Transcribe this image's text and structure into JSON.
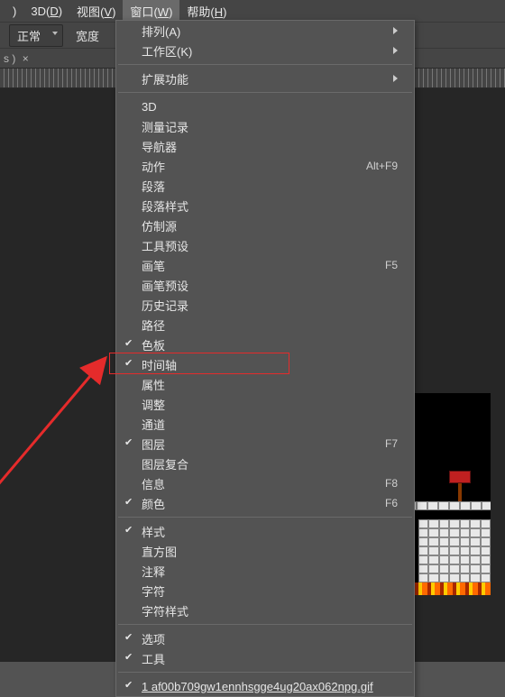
{
  "menubar": {
    "items": [
      {
        "left": ")",
        "right": ""
      },
      {
        "left": "3D",
        "right": "D"
      },
      {
        "left": "视图",
        "right": "V"
      },
      {
        "left": "窗口",
        "right": "W"
      },
      {
        "left": "帮助",
        "right": "H"
      }
    ],
    "active_index": 3
  },
  "toolbar": {
    "mode_label": "正常",
    "width_label": "宽度"
  },
  "tab": {
    "label": "s )",
    "close": "×"
  },
  "menu": {
    "items": [
      {
        "label": "排列(A)",
        "kind": "sub",
        "checked": false
      },
      {
        "label": "工作区(K)",
        "kind": "sub",
        "checked": false
      },
      {
        "kind": "sep"
      },
      {
        "label": "扩展功能",
        "kind": "sub",
        "checked": false
      },
      {
        "kind": "sep"
      },
      {
        "label": "3D",
        "kind": "item",
        "checked": false
      },
      {
        "label": "测量记录",
        "kind": "item",
        "checked": false
      },
      {
        "label": "导航器",
        "kind": "item",
        "checked": false
      },
      {
        "label": "动作",
        "kind": "item",
        "checked": false,
        "shortcut": "Alt+F9"
      },
      {
        "label": "段落",
        "kind": "item",
        "checked": false
      },
      {
        "label": "段落样式",
        "kind": "item",
        "checked": false
      },
      {
        "label": "仿制源",
        "kind": "item",
        "checked": false
      },
      {
        "label": "工具预设",
        "kind": "item",
        "checked": false
      },
      {
        "label": "画笔",
        "kind": "item",
        "checked": false,
        "shortcut": "F5"
      },
      {
        "label": "画笔预设",
        "kind": "item",
        "checked": false
      },
      {
        "label": "历史记录",
        "kind": "item",
        "checked": false
      },
      {
        "label": "路径",
        "kind": "item",
        "checked": false
      },
      {
        "label": "色板",
        "kind": "item",
        "checked": true
      },
      {
        "label": "时间轴",
        "kind": "item",
        "checked": true,
        "highlight": true
      },
      {
        "label": "属性",
        "kind": "item",
        "checked": false
      },
      {
        "label": "调整",
        "kind": "item",
        "checked": false
      },
      {
        "label": "通道",
        "kind": "item",
        "checked": false
      },
      {
        "label": "图层",
        "kind": "item",
        "checked": true,
        "shortcut": "F7"
      },
      {
        "label": "图层复合",
        "kind": "item",
        "checked": false
      },
      {
        "label": "信息",
        "kind": "item",
        "checked": false,
        "shortcut": "F8"
      },
      {
        "label": "颜色",
        "kind": "item",
        "checked": true,
        "shortcut": "F6"
      },
      {
        "kind": "sep"
      },
      {
        "label": "样式",
        "kind": "item",
        "checked": true
      },
      {
        "label": "直方图",
        "kind": "item",
        "checked": false
      },
      {
        "label": "注释",
        "kind": "item",
        "checked": false
      },
      {
        "label": "字符",
        "kind": "item",
        "checked": false
      },
      {
        "label": "字符样式",
        "kind": "item",
        "checked": false
      },
      {
        "kind": "sep"
      },
      {
        "label": "选项",
        "kind": "item",
        "checked": true
      },
      {
        "label": "工具",
        "kind": "item",
        "checked": true
      },
      {
        "kind": "sep"
      },
      {
        "label": "1 af00b709gw1ennhsgge4ug20ax062npg.gif",
        "kind": "item",
        "checked": true,
        "underline": true
      }
    ]
  }
}
